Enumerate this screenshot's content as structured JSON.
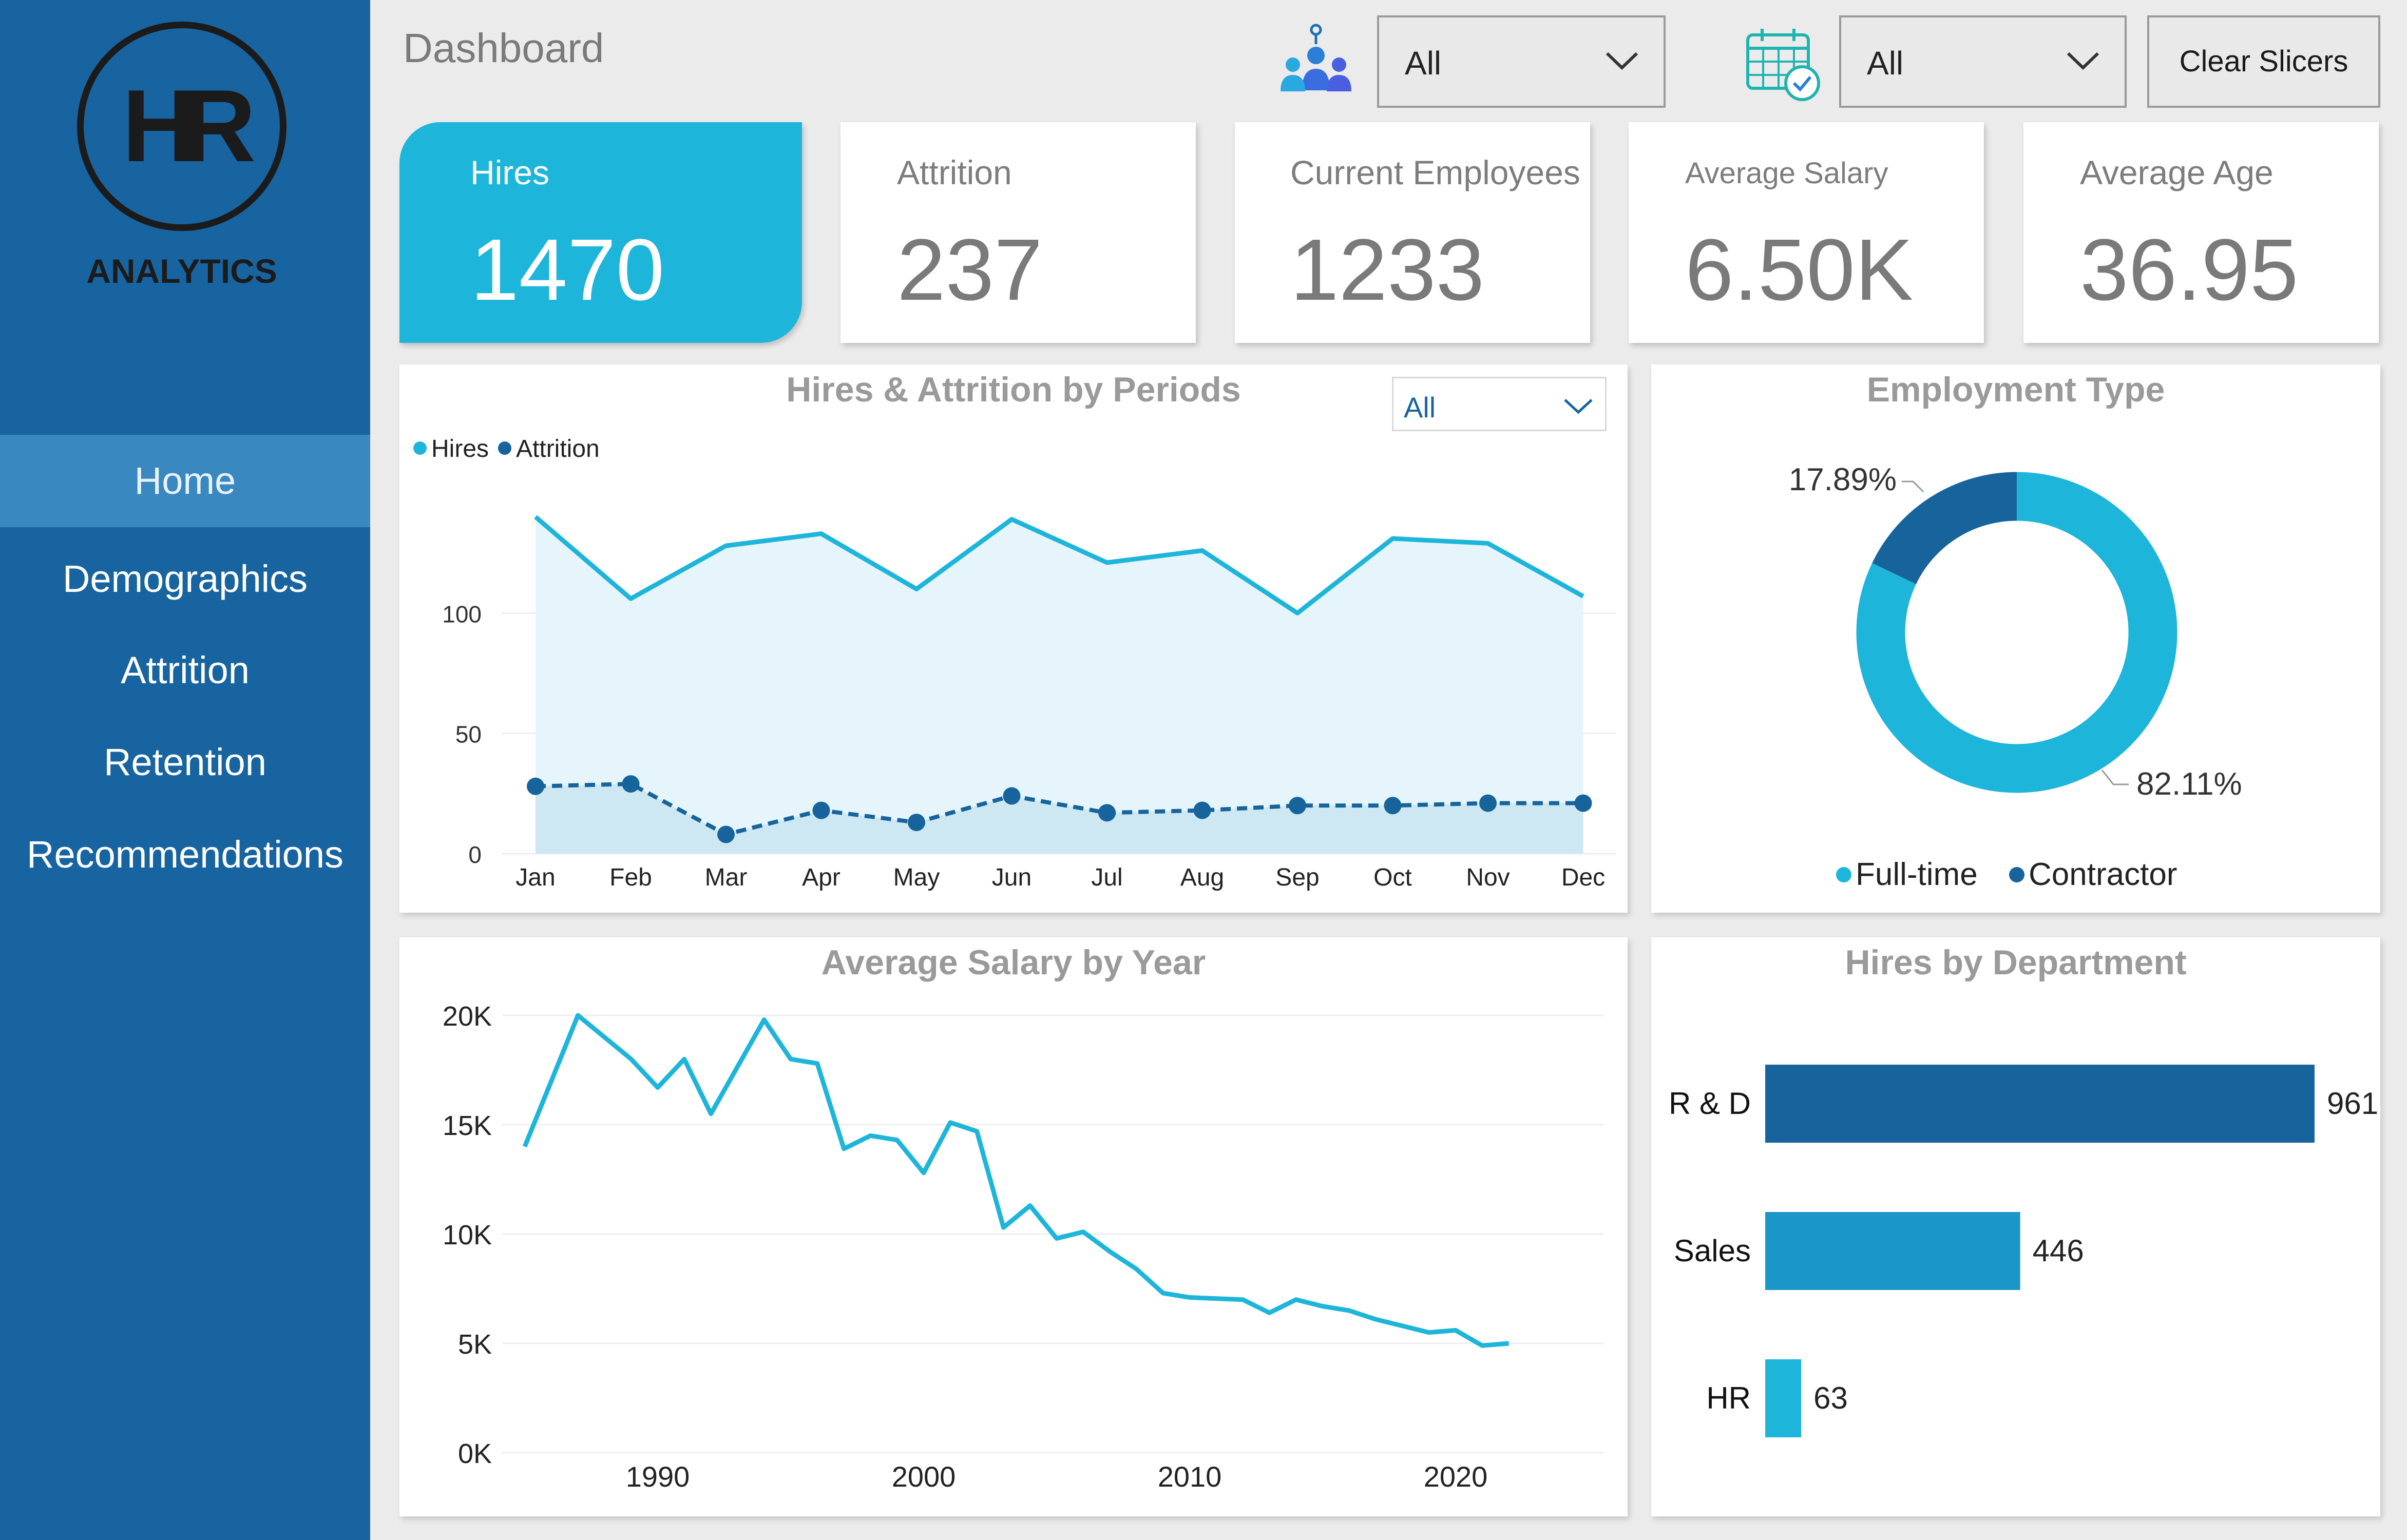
{
  "sidebar": {
    "logo_mark": "HR",
    "logo_text": "ANALYTICS",
    "nav": [
      "Home",
      "Demographics",
      "Attrition",
      "Retention",
      "Recommendations"
    ]
  },
  "header": {
    "title": "Dashboard",
    "slicer_department": "All",
    "slicer_date": "All",
    "clear_label": "Clear Slicers"
  },
  "kpis": [
    {
      "label": "Hires",
      "value": "1470"
    },
    {
      "label": "Attrition",
      "value": "237"
    },
    {
      "label": "Current Employees",
      "value": "1233"
    },
    {
      "label": "Average Salary",
      "value": "6.50K"
    },
    {
      "label": "Average Age",
      "value": "36.95"
    }
  ],
  "colors": {
    "sidebar": "#1864a0",
    "accent": "#1eb5da",
    "dark_series": "#17649c",
    "mid_series": "#1a96c8"
  },
  "chart_data": [
    {
      "type": "line",
      "title": "Hires & Attrition by Periods",
      "filter": "All",
      "categories": [
        "Jan",
        "Feb",
        "Mar",
        "Apr",
        "May",
        "Jun",
        "Jul",
        "Aug",
        "Sep",
        "Oct",
        "Nov",
        "Dec"
      ],
      "series": [
        {
          "name": "Hires",
          "values": [
            140,
            106,
            128,
            133,
            110,
            139,
            121,
            126,
            100,
            131,
            129,
            107
          ]
        },
        {
          "name": "Attrition",
          "values": [
            28,
            29,
            8,
            18,
            13,
            24,
            17,
            18,
            20,
            20,
            21,
            21
          ]
        }
      ],
      "yticks": [
        0,
        50,
        100
      ],
      "ylim": [
        0,
        150
      ],
      "legend": "top-left",
      "grid": true
    },
    {
      "type": "pie",
      "title": "Employment Type",
      "labels": [
        "Full-time",
        "Contractor"
      ],
      "values": [
        82.11,
        17.89
      ],
      "value_labels": [
        "82.11%",
        "17.89%"
      ],
      "legend": "bottom"
    },
    {
      "type": "line",
      "title": "Average Salary by Year",
      "x": [
        1985,
        1987,
        1989,
        1990,
        1991,
        1992,
        1994,
        1995,
        1996,
        1997,
        1998,
        1999,
        2000,
        2001,
        2002,
        2003,
        2004,
        2005,
        2006,
        2007,
        2008,
        2009,
        2010,
        2012,
        2013,
        2014,
        2015,
        2016,
        2017,
        2018,
        2019,
        2020,
        2021,
        2022
      ],
      "y": [
        14000,
        20000,
        18000,
        16700,
        18000,
        15500,
        19800,
        18000,
        17800,
        13900,
        14500,
        14300,
        12800,
        15100,
        14700,
        10300,
        11300,
        9800,
        10100,
        9200,
        8400,
        7300,
        7100,
        7000,
        6400,
        7000,
        6700,
        6500,
        6100,
        5800,
        5500,
        5600,
        4900,
        5000
      ],
      "xticks": [
        1990,
        2000,
        2010,
        2020
      ],
      "ytick_labels": [
        "0K",
        "5K",
        "10K",
        "15K",
        "20K"
      ],
      "ylim": [
        0,
        20000
      ],
      "grid": true
    },
    {
      "type": "bar",
      "orientation": "horizontal",
      "title": "Hires by Department",
      "categories": [
        "R & D",
        "Sales",
        "HR"
      ],
      "values": [
        961,
        446,
        63
      ]
    }
  ]
}
